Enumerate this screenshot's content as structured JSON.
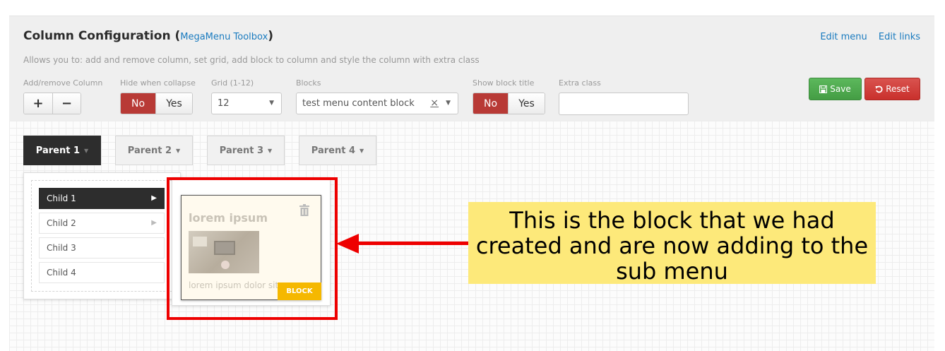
{
  "header": {
    "title": "Column Configuration",
    "paren_open": "(",
    "toolbox_link": "MegaMenu Toolbox",
    "paren_close": ")",
    "edit_menu": "Edit menu",
    "edit_links": "Edit links",
    "description": "Allows you to: add and remove column, set grid, add block to column and style the column with extra class"
  },
  "controls": {
    "add_remove_label": "Add/remove Column",
    "plus": "+",
    "minus": "−",
    "hide_collapse_label": "Hide when collapse",
    "hide_no": "No",
    "hide_yes": "Yes",
    "grid_label": "Grid (1-12)",
    "grid_value": "12",
    "blocks_label": "Blocks",
    "blocks_value": "test menu content block",
    "blocks_clear": "×",
    "show_title_label": "Show block title",
    "show_no": "No",
    "show_yes": "Yes",
    "extra_class_label": "Extra class",
    "extra_class_value": "",
    "save": "Save",
    "reset": "Reset"
  },
  "parents": [
    {
      "label": "Parent 1",
      "active": true
    },
    {
      "label": "Parent 2",
      "active": false
    },
    {
      "label": "Parent 3",
      "active": false
    },
    {
      "label": "Parent 4",
      "active": false
    }
  ],
  "children": [
    {
      "label": "Child 1",
      "active": true
    },
    {
      "label": "Child 2",
      "active": false
    },
    {
      "label": "Child 3",
      "active": false
    },
    {
      "label": "Child 4",
      "active": false
    }
  ],
  "block": {
    "title": "lorem ipsum",
    "text": "lorem ipsum dolor sit",
    "badge": "BLOCK"
  },
  "annotation": {
    "line1": "This is the block that we had",
    "line2": "created and are now adding to the",
    "line3": "sub menu"
  },
  "colors": {
    "active_red": "#b83a36",
    "save_green": "#5cb85c",
    "reset_red": "#d9534f",
    "annotation_bg": "#fde97a",
    "highlight": "#ee0000",
    "badge": "#f5b800",
    "link": "#1a7bbf"
  },
  "icons": {
    "save": "floppy-disk-icon",
    "reset": "undo-icon",
    "trash": "trash-icon",
    "caret": "caret-down-icon",
    "arrow": "arrow-left-icon"
  }
}
